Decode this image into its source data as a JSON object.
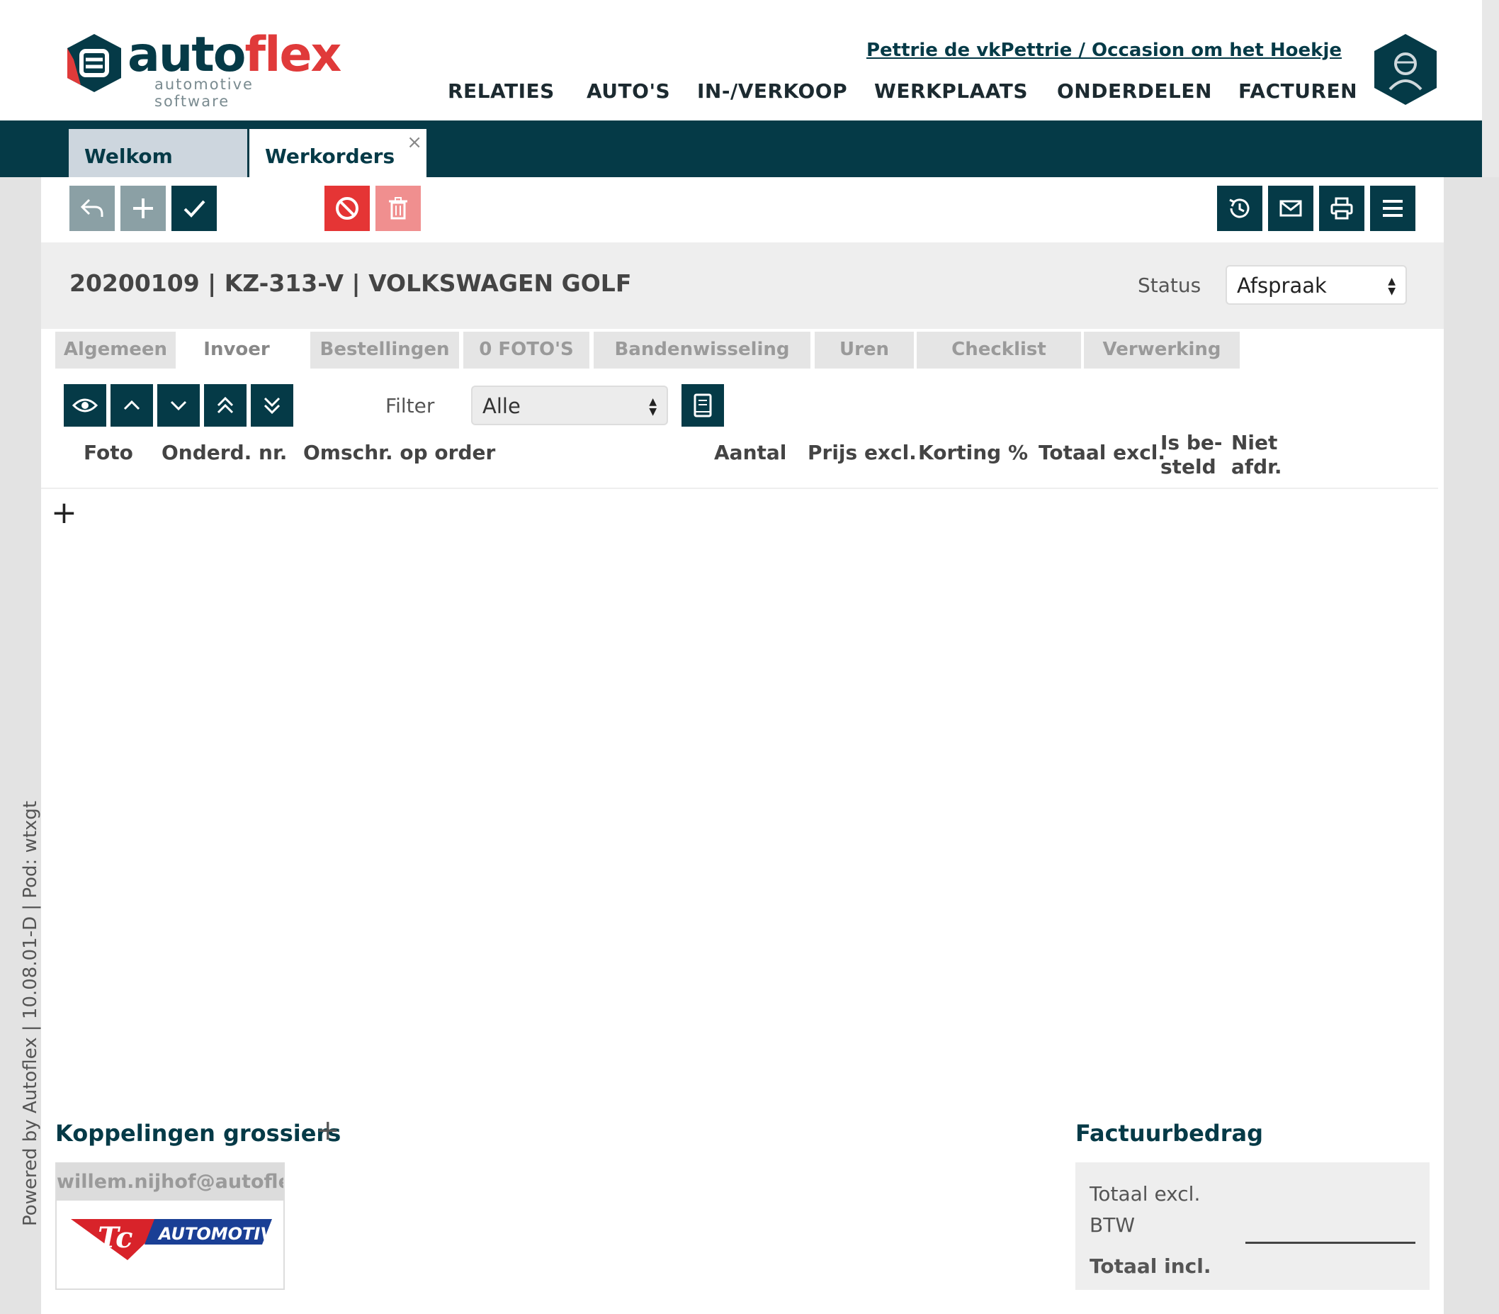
{
  "brand": {
    "name_part1": "auto",
    "name_part2": "flex",
    "tagline": "automotive software"
  },
  "header": {
    "user_link": "Pettrie de vkPettrie / Occasion om het Hoekje"
  },
  "nav": [
    "RELATIES",
    "AUTO'S",
    "IN-/VERKOOP",
    "WERKPLAATS",
    "ONDERDELEN",
    "FACTUREN"
  ],
  "doc_tabs": {
    "welkom": "Welkom",
    "werkorders": "Werkorders",
    "close": "×"
  },
  "footer_side": "Powered by Autoflex | 10.08.01-D | Pod: wtxgt",
  "workorder": {
    "title": "20200109 | KZ-313-V | VOLKSWAGEN GOLF",
    "status_label": "Status",
    "status_value": "Afspraak"
  },
  "section_tabs": [
    "Algemeen",
    "Invoer",
    "Bestellingen",
    "0 FOTO'S",
    "Bandenwisseling",
    "Uren",
    "Checklist",
    "Verwerking"
  ],
  "active_section_tab": "Invoer",
  "filter": {
    "label": "Filter",
    "value": "Alle"
  },
  "columns": {
    "foto": "Foto",
    "onderd_nr": "Onderd. nr.",
    "omschr": "Omschr. op order",
    "aantal": "Aantal",
    "prijs": "Prijs excl.",
    "korting": "Korting %",
    "totaal": "Totaal excl.",
    "besteld_1": "Is be-",
    "besteld_2": "steld",
    "niet_1": "Niet",
    "niet_2": "afdr."
  },
  "add_row": "+",
  "koppelingen": {
    "title": "Koppelingen grossiers",
    "add": "+",
    "email": "willem.nijhof@autoflex.",
    "supplier_logo_text": "AUTOMOTIVE"
  },
  "factuurbedrag": {
    "title": "Factuurbedrag",
    "totaal_excl": "Totaal excl.",
    "btw": "BTW",
    "totaal_incl": "Totaal incl."
  },
  "colors": {
    "dark_teal": "#053a47",
    "accent_red": "#e03a3a",
    "gray_button": "#8ba0a5"
  }
}
